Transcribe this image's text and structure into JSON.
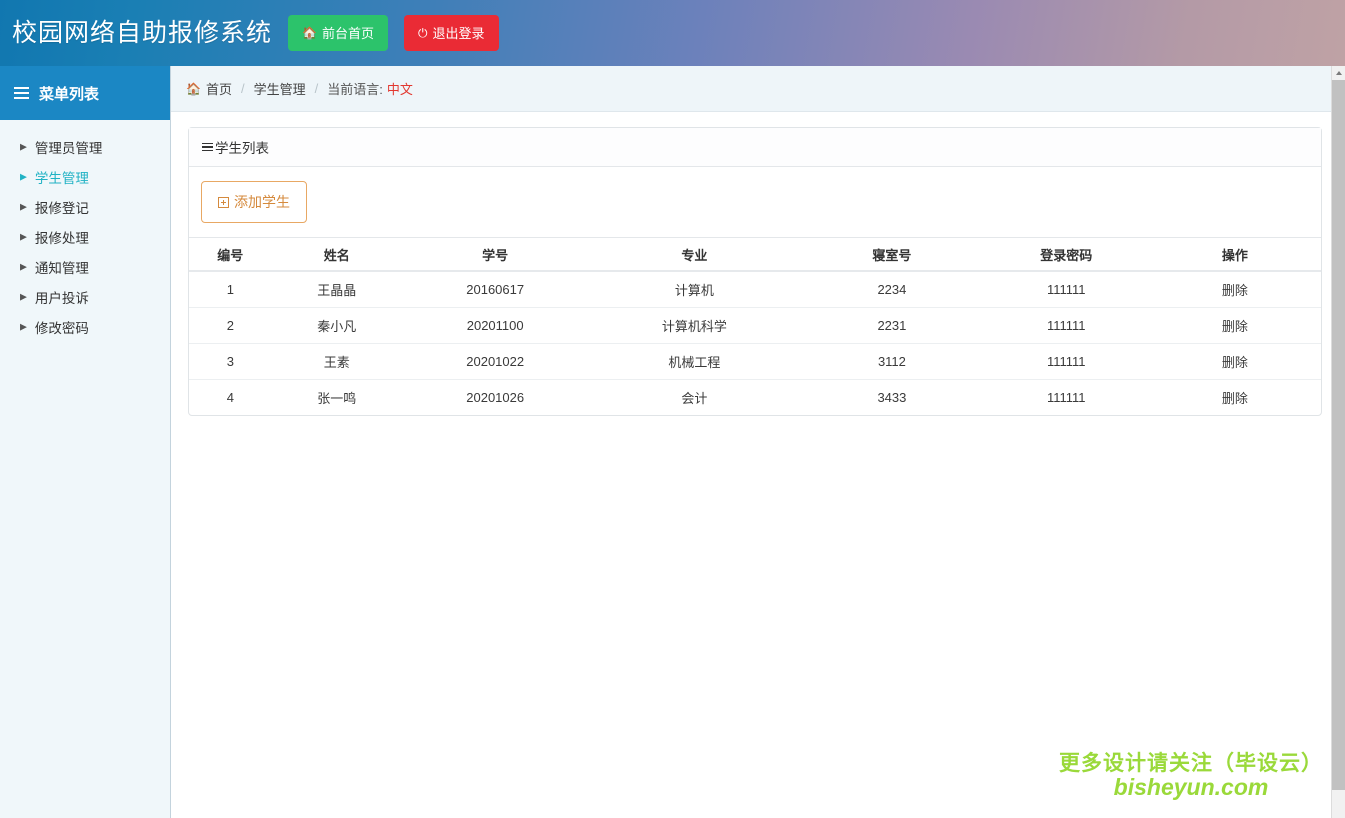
{
  "header": {
    "brand": "校园网络自助报修系统",
    "buttons": [
      {
        "label": "前台首页",
        "icon": "home-icon",
        "color": "#2cc36b"
      },
      {
        "label": "退出登录",
        "icon": "power-icon",
        "color": "#ea2b35"
      }
    ]
  },
  "sidebar": {
    "title": "菜单列表",
    "icon": "menu-list-icon",
    "items": [
      {
        "label": "管理员管理",
        "active": false
      },
      {
        "label": "学生管理",
        "active": true
      },
      {
        "label": "报修登记",
        "active": false
      },
      {
        "label": "报修处理",
        "active": false
      },
      {
        "label": "通知管理",
        "active": false
      },
      {
        "label": "用户投诉",
        "active": false
      },
      {
        "label": "修改密码",
        "active": false
      }
    ],
    "active_color": "#20b2c4"
  },
  "breadcrumb": {
    "home_icon": "home-icon",
    "home": "首页",
    "separator": "/",
    "section": "学生管理",
    "language_label": "当前语言:",
    "language_value": "中文",
    "language_color": "#e2372f"
  },
  "panel": {
    "title": "学生列表",
    "title_icon": "bars-icon",
    "add_button": {
      "label": "添加学生",
      "icon": "plus-square-icon",
      "color": "#d58a3d"
    }
  },
  "table": {
    "columns": [
      "编号",
      "姓名",
      "学号",
      "专业",
      "寝室号",
      "登录密码",
      "操作"
    ],
    "rows": [
      {
        "id": "1",
        "name": "王晶晶",
        "student_no": "20160617",
        "major": "计算机",
        "dorm": "2234",
        "password": "111111",
        "action": "删除"
      },
      {
        "id": "2",
        "name": "秦小凡",
        "student_no": "20201100",
        "major": "计算机科学",
        "dorm": "2231",
        "password": "111111",
        "action": "删除"
      },
      {
        "id": "3",
        "name": "王素",
        "student_no": "20201022",
        "major": "机械工程",
        "dorm": "3112",
        "password": "111111",
        "action": "删除"
      },
      {
        "id": "4",
        "name": "张一鸣",
        "student_no": "20201026",
        "major": "会计",
        "dorm": "3433",
        "password": "111111",
        "action": "删除"
      }
    ]
  },
  "watermark": {
    "line1": "更多设计请关注（毕设云）",
    "line2": "bisheyun.com",
    "color": "#9ad93a"
  }
}
